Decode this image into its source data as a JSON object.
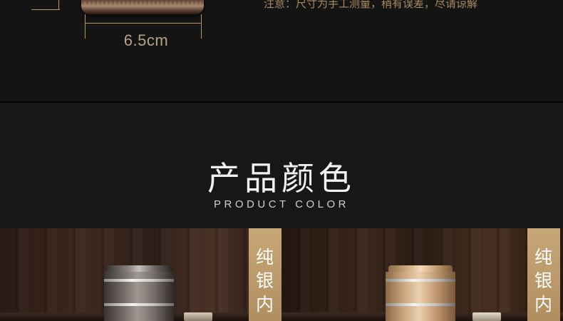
{
  "dimension": {
    "label": "6.5cm",
    "note": "注意：尺寸为手工测量，稍有误差，尽请谅解"
  },
  "color_section": {
    "title": "产品颜色",
    "subtitle": "PRODUCT COLOR"
  },
  "cards": [
    {
      "badge_chars": [
        "纯",
        "银",
        "内"
      ]
    },
    {
      "badge_chars": [
        "纯",
        "银",
        "内"
      ]
    }
  ]
}
